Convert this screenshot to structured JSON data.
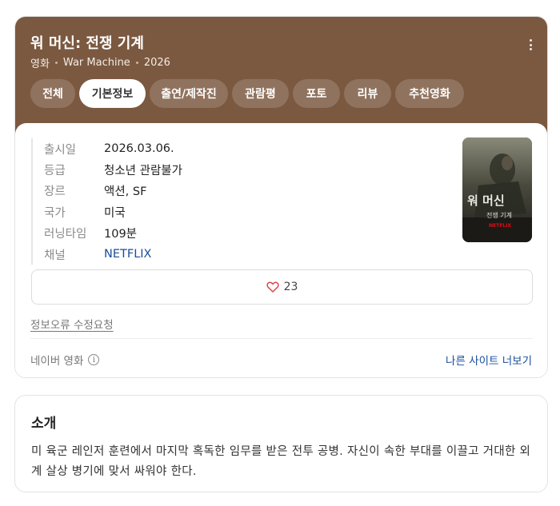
{
  "header": {
    "title": "워 머신: 전쟁 기계",
    "category": "영화",
    "original_title": "War Machine",
    "year": "2026"
  },
  "tabs": [
    {
      "label": "전체",
      "active": false
    },
    {
      "label": "기본정보",
      "active": true
    },
    {
      "label": "출연/제작진",
      "active": false
    },
    {
      "label": "관람평",
      "active": false
    },
    {
      "label": "포토",
      "active": false
    },
    {
      "label": "리뷰",
      "active": false
    },
    {
      "label": "추천영화",
      "active": false
    }
  ],
  "info": [
    {
      "label": "출시일",
      "value": "2026.03.06."
    },
    {
      "label": "등급",
      "value": "청소년 관람불가"
    },
    {
      "label": "장르",
      "value": "액션, SF"
    },
    {
      "label": "국가",
      "value": "미국"
    },
    {
      "label": "러닝타임",
      "value": "109분"
    },
    {
      "label": "채널",
      "value": "NETFLIX"
    }
  ],
  "poster": {
    "title_big": "워 머신",
    "subtitle": "전쟁 기계",
    "brand": "NETFLIX"
  },
  "like": {
    "icon": "heart-icon",
    "count": "23"
  },
  "report_link": "정보오류 수정요청",
  "source": {
    "label": "네이버 영화",
    "info_icon": "i"
  },
  "other_sites": "나른 사이트 너보기",
  "intro": {
    "title": "소개",
    "text": "미 육군 레인저 훈련에서 마지막 혹독한 임무를 받은 전투 공병. 자신이 속한 부대를 이끌고 거대한 외계 살상 병기에 맞서 싸워야 한다."
  },
  "colors": {
    "hero_bg": "#7b5940",
    "link": "#1a4d9c",
    "heart": "#e0474c"
  }
}
